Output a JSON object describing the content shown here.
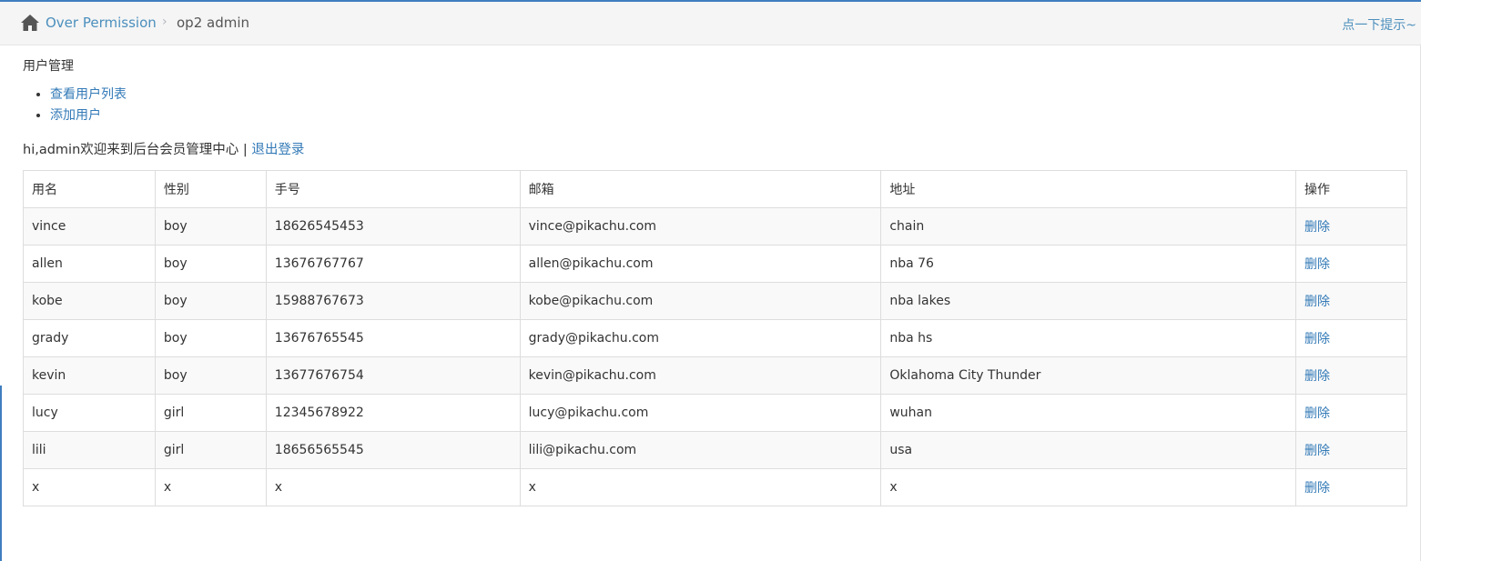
{
  "breadcrumbs": {
    "home_label": "Over Permission",
    "separator": "›",
    "active": "op2 admin",
    "tip": "点一下提示~"
  },
  "section_title": "用户管理",
  "menu": [
    {
      "label": "查看用户列表"
    },
    {
      "label": "添加用户"
    }
  ],
  "welcome": {
    "text": "hi,admin欢迎来到后台会员管理中心 | ",
    "logout": "退出登录"
  },
  "table": {
    "headers": [
      "用名",
      "性别",
      "手号",
      "邮箱",
      "地址",
      "操作"
    ],
    "rows": [
      [
        "vince",
        "boy",
        "18626545453",
        "vince@pikachu.com",
        "chain",
        "删除"
      ],
      [
        "allen",
        "boy",
        "13676767767",
        "allen@pikachu.com",
        "nba 76",
        "删除"
      ],
      [
        "kobe",
        "boy",
        "15988767673",
        "kobe@pikachu.com",
        "nba lakes",
        "删除"
      ],
      [
        "grady",
        "boy",
        "13676765545",
        "grady@pikachu.com",
        "nba hs",
        "删除"
      ],
      [
        "kevin",
        "boy",
        "13677676754",
        "kevin@pikachu.com",
        "Oklahoma City Thunder",
        "删除"
      ],
      [
        "lucy",
        "girl",
        "12345678922",
        "lucy@pikachu.com",
        "wuhan",
        "删除"
      ],
      [
        "lili",
        "girl",
        "18656565545",
        "lili@pikachu.com",
        "usa",
        "删除"
      ],
      [
        "x",
        "x",
        "x",
        "x",
        "x",
        "删除"
      ]
    ]
  },
  "icons": {
    "home": "home-icon"
  },
  "colors": {
    "link": "#337ab7",
    "breadcrumb_link": "#4c8fbd",
    "accent": "#3f7dbf"
  }
}
